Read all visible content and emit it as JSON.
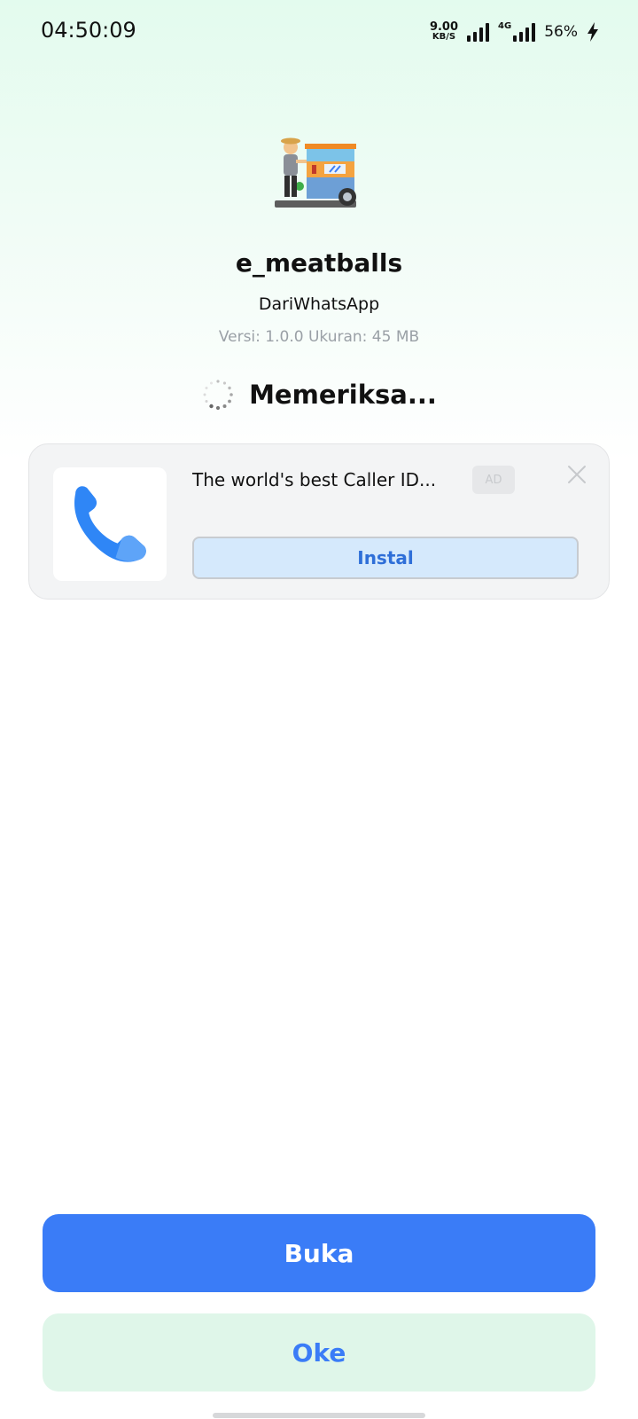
{
  "status_bar": {
    "time": "04:50:09",
    "net_speed_value": "9.00",
    "net_speed_unit": "KB/S",
    "network_type": "4G",
    "battery_percent": "56%",
    "icons": [
      "cellular-signal-icon",
      "cellular-4g-signal-icon",
      "charging-icon"
    ]
  },
  "app": {
    "icon": "meatball-cart-app-icon",
    "name": "e_meatballs",
    "source": "DariWhatsApp",
    "meta": "Versi: 1.0.0 Ukuran: 45 MB"
  },
  "status": {
    "label": "Memeriksa...",
    "icon": "loading-spinner-icon"
  },
  "ad": {
    "icon": "phone-icon",
    "title": "The world's best Caller ID...",
    "badge": "AD",
    "install_label": "Instal",
    "close_icon": "close-icon"
  },
  "actions": {
    "open_label": "Buka",
    "ok_label": "Oke"
  },
  "colors": {
    "primary": "#3a7cf7",
    "secondary_bg": "#dff6e9",
    "install_bg": "#d5e9fc",
    "ad_card_bg": "#f3f4f5"
  }
}
